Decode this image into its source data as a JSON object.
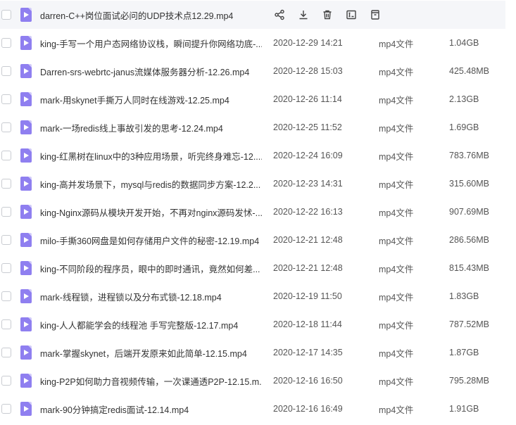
{
  "files": [
    {
      "name": "darren-C++岗位面试必问的UDP技术点12.29.mp4",
      "date": "",
      "type": "",
      "size": "",
      "hover": true
    },
    {
      "name": "king-手写一个用户态网络协议栈，瞬间提升你网络功底-...",
      "date": "2020-12-29 14:21",
      "type": "mp4文件",
      "size": "1.04GB"
    },
    {
      "name": "Darren-srs-webrtc-janus流媒体服务器分析-12.26.mp4",
      "date": "2020-12-28 15:03",
      "type": "mp4文件",
      "size": "425.48MB"
    },
    {
      "name": "mark-用skynet手撕万人同时在线游戏-12.25.mp4",
      "date": "2020-12-26 11:14",
      "type": "mp4文件",
      "size": "2.13GB"
    },
    {
      "name": "mark-一场redis线上事故引发的思考-12.24.mp4",
      "date": "2020-12-25 11:52",
      "type": "mp4文件",
      "size": "1.69GB"
    },
    {
      "name": "king-红黑树在linux中的3种应用场景，听完终身难忘-12....",
      "date": "2020-12-24 16:09",
      "type": "mp4文件",
      "size": "783.76MB"
    },
    {
      "name": "king-高并发场景下，mysql与redis的数据同步方案-12.2...",
      "date": "2020-12-23 14:31",
      "type": "mp4文件",
      "size": "315.60MB"
    },
    {
      "name": "king-Nginx源码从模块开发开始，不再对nginx源码发怵-...",
      "date": "2020-12-22 16:13",
      "type": "mp4文件",
      "size": "907.69MB"
    },
    {
      "name": "milo-手撕360网盘是如何存储用户文件的秘密-12.19.mp4",
      "date": "2020-12-21 12:48",
      "type": "mp4文件",
      "size": "286.56MB"
    },
    {
      "name": "king-不同阶段的程序员，眼中的即时通讯，竟然如何差...",
      "date": "2020-12-21 12:48",
      "type": "mp4文件",
      "size": "815.43MB"
    },
    {
      "name": "mark-线程锁，进程锁以及分布式锁-12.18.mp4",
      "date": "2020-12-19 11:50",
      "type": "mp4文件",
      "size": "1.83GB"
    },
    {
      "name": "king-人人都能学会的线程池 手写完整版-12.17.mp4",
      "date": "2020-12-18 11:44",
      "type": "mp4文件",
      "size": "787.52MB"
    },
    {
      "name": "mark-掌握skynet，后端开发原来如此简单-12.15.mp4",
      "date": "2020-12-17 14:35",
      "type": "mp4文件",
      "size": "1.87GB"
    },
    {
      "name": "king-P2P如何助力音视频传输，一次课通透P2P-12.15.m...",
      "date": "2020-12-16 16:50",
      "type": "mp4文件",
      "size": "795.28MB"
    },
    {
      "name": "mark-90分钟搞定redis面试-12.14.mp4",
      "date": "2020-12-16 16:49",
      "type": "mp4文件",
      "size": "1.91GB"
    }
  ],
  "hover_actions": [
    "share-icon",
    "download-icon",
    "delete-icon",
    "rename-icon",
    "more-icon"
  ],
  "colors": {
    "file_icon": "#8f7ff0",
    "hover_bg": "#f5f6f9"
  }
}
